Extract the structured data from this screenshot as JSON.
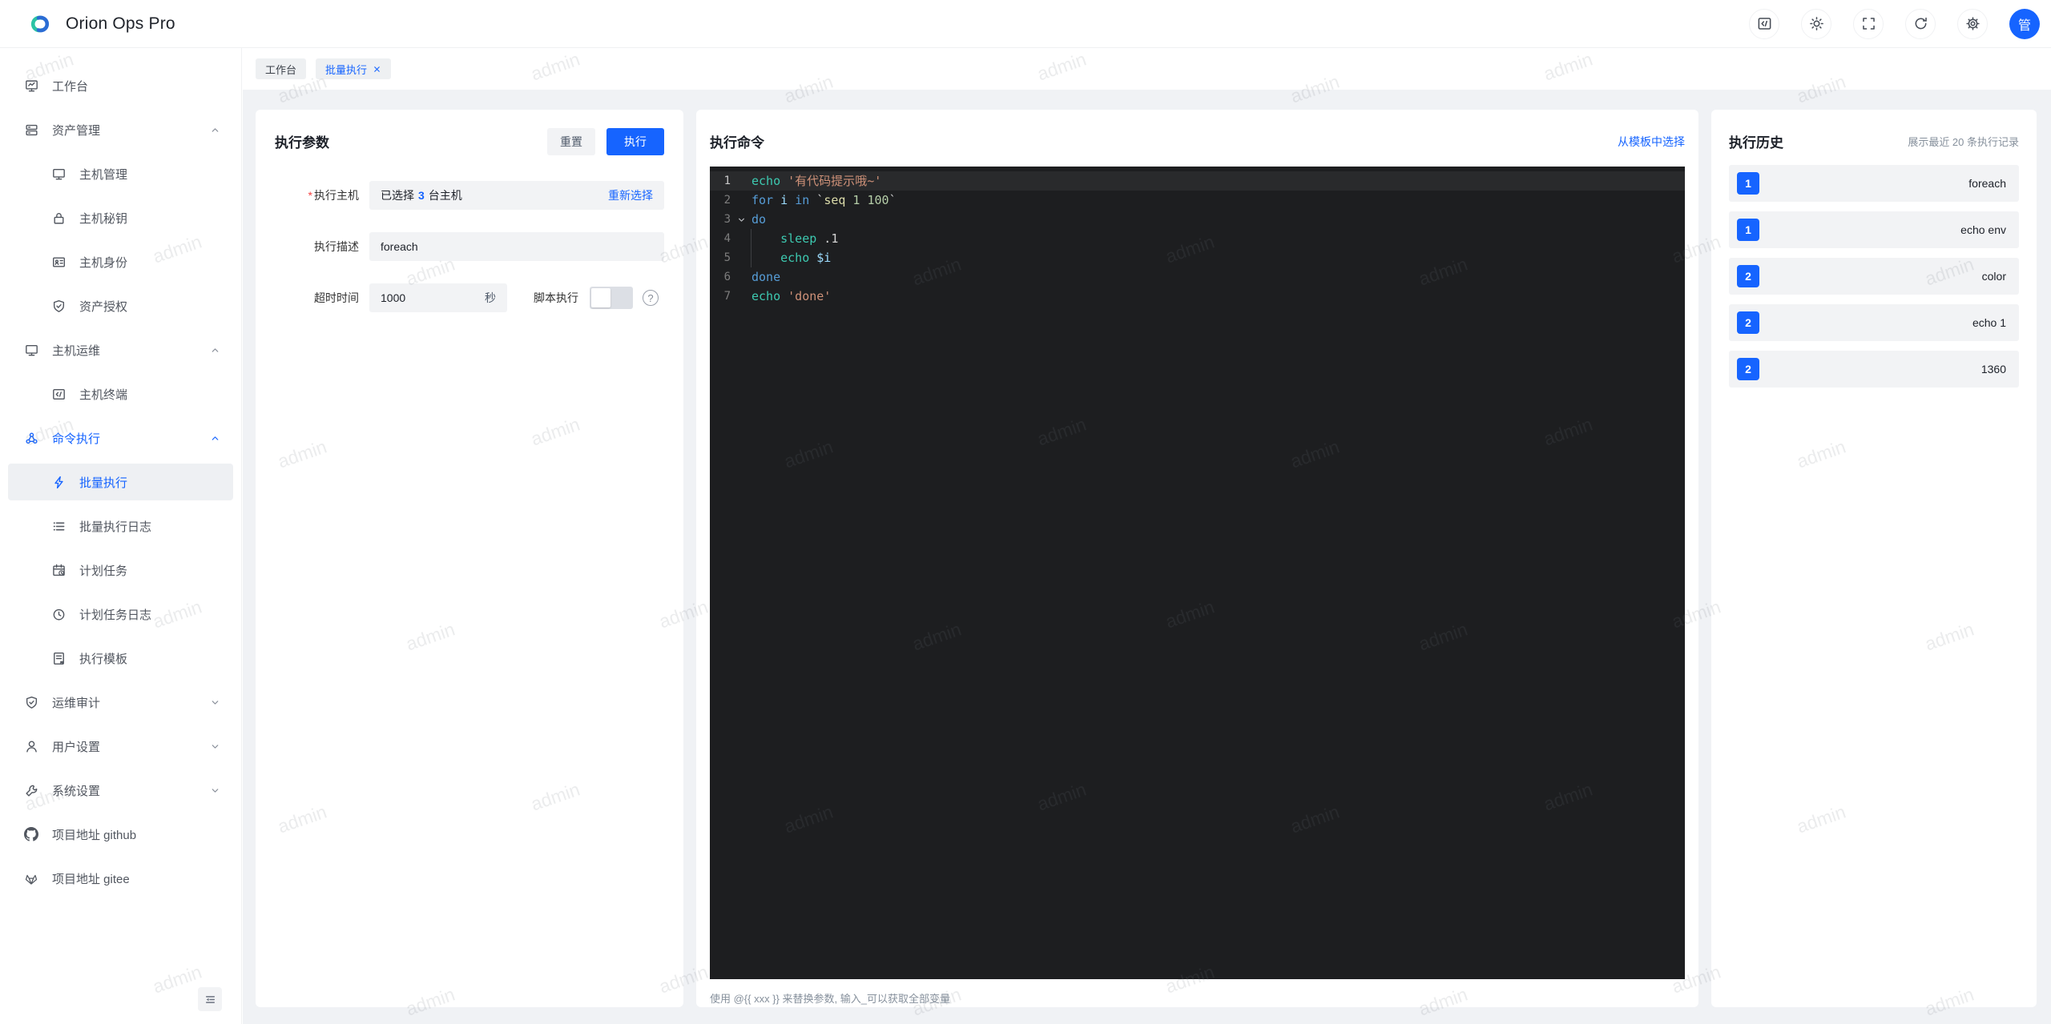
{
  "app": {
    "title": "Orion Ops Pro",
    "avatar_text": "管"
  },
  "colors": {
    "accent": "#1664ff",
    "editor_bg": "#1d1e20",
    "badge": "#1664ff"
  },
  "tabs": [
    {
      "label": "工作台"
    },
    {
      "label": "批量执行"
    }
  ],
  "sidebar": {
    "items": [
      {
        "label": "工作台"
      },
      {
        "label": "资产管理"
      },
      {
        "label": "主机管理"
      },
      {
        "label": "主机秘钥"
      },
      {
        "label": "主机身份"
      },
      {
        "label": "资产授权"
      },
      {
        "label": "主机运维"
      },
      {
        "label": "主机终端"
      },
      {
        "label": "命令执行"
      },
      {
        "label": "批量执行"
      },
      {
        "label": "批量执行日志"
      },
      {
        "label": "计划任务"
      },
      {
        "label": "计划任务日志"
      },
      {
        "label": "执行模板"
      },
      {
        "label": "运维审计"
      },
      {
        "label": "用户设置"
      },
      {
        "label": "系统设置"
      },
      {
        "label": "项目地址 github"
      },
      {
        "label": "项目地址 gitee"
      }
    ]
  },
  "params": {
    "title": "执行参数",
    "reset_label": "重置",
    "execute_label": "执行",
    "host": {
      "label": "执行主机",
      "prefix": "已选择",
      "count": "3",
      "suffix": "台主机",
      "action": "重新选择"
    },
    "desc": {
      "label": "执行描述",
      "value": "foreach"
    },
    "timeout": {
      "label": "超时时间",
      "value": "1000",
      "unit": "秒"
    },
    "script": {
      "label": "脚本执行",
      "enabled": false
    }
  },
  "command": {
    "title": "执行命令",
    "template_link": "从模板中选择",
    "hint": "使用 @{{ xxx }} 来替换参数, 输入_可以获取全部变量",
    "lines": [
      {
        "num": "1",
        "tokens": [
          "echo",
          " ",
          "'有代码提示哦~'"
        ]
      },
      {
        "num": "2",
        "tokens": [
          "for",
          " ",
          "i",
          " ",
          "in",
          " `",
          "seq",
          " 1 100",
          "`"
        ]
      },
      {
        "num": "3",
        "tokens": [
          "do"
        ]
      },
      {
        "num": "4",
        "tokens": [
          "    ",
          "sleep",
          " .1"
        ]
      },
      {
        "num": "5",
        "tokens": [
          "    ",
          "echo",
          " ",
          "$i"
        ]
      },
      {
        "num": "6",
        "tokens": [
          "done"
        ]
      },
      {
        "num": "7",
        "tokens": [
          "echo",
          " ",
          "'done'"
        ]
      }
    ]
  },
  "history": {
    "title": "执行历史",
    "note": "展示最近 20 条执行记录",
    "items": [
      {
        "badge": "1",
        "label": "foreach"
      },
      {
        "badge": "1",
        "label": "echo env"
      },
      {
        "badge": "2",
        "label": "color"
      },
      {
        "badge": "2",
        "label": "echo 1"
      },
      {
        "badge": "2",
        "label": "1360"
      }
    ]
  },
  "watermark": {
    "text": "admin"
  }
}
